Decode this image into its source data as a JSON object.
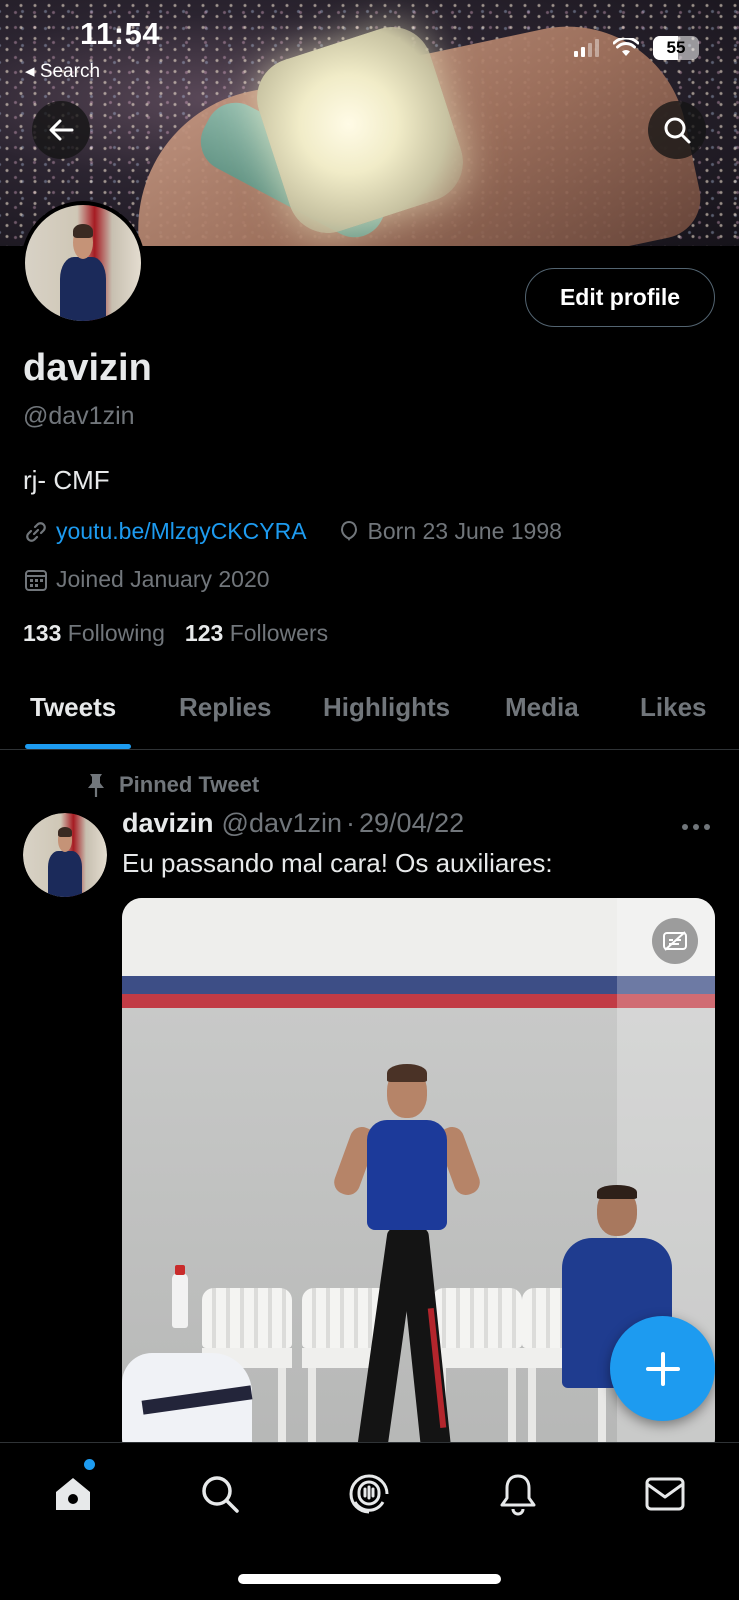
{
  "status_bar": {
    "time": "11:54",
    "back_label": "◂ Search",
    "battery": "55",
    "battery_level": 0.55,
    "icons": [
      "cellular-signal-icon",
      "wifi-icon",
      "battery-icon"
    ]
  },
  "header": {
    "back_icon": "arrow-left-icon",
    "search_icon": "search-icon"
  },
  "profile": {
    "name": "davizin",
    "handle": "@dav1zin",
    "bio": "rj- CMF",
    "website": "youtu.be/MlzqyCKCYRA",
    "birthday": "Born 23 June 1998",
    "joined": "Joined January 2020",
    "following_count": "133",
    "following_label": "Following",
    "followers_count": "123",
    "followers_label": "Followers",
    "edit_label": "Edit profile"
  },
  "tabs": [
    {
      "label": "Tweets",
      "active": true
    },
    {
      "label": "Replies",
      "active": false
    },
    {
      "label": "Highlights",
      "active": false
    },
    {
      "label": "Media",
      "active": false
    },
    {
      "label": "Likes",
      "active": false
    }
  ],
  "pinned_tweet": {
    "pinned_label": "Pinned Tweet",
    "author": "davizin",
    "handle": "@dav1zin",
    "separator": "·",
    "date": "29/04/22",
    "text": "Eu passando mal cara! Os auxiliares:"
  },
  "nav": {
    "items": [
      "home-icon",
      "search-icon",
      "spaces-icon",
      "notifications-icon",
      "messages-icon"
    ],
    "home_has_badge": true
  },
  "colors": {
    "accent": "#1d9bf0",
    "background": "#000000",
    "text_primary": "#e7e9ea",
    "text_secondary": "#71767b",
    "border": "#2f3336"
  }
}
